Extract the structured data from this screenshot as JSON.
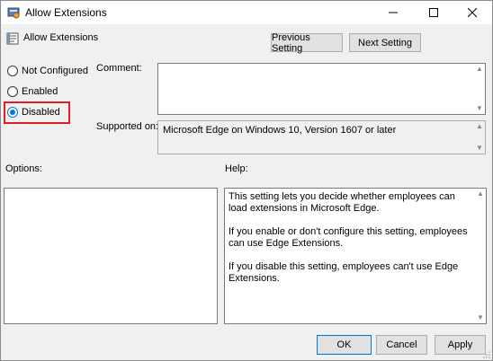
{
  "window": {
    "title": "Allow Extensions",
    "app_icon": "group-policy-icon",
    "controls": [
      "minimize-icon",
      "maximize-icon",
      "close-icon"
    ]
  },
  "header": {
    "policy_name": "Allow Extensions",
    "policy_icon": "policy-setting-icon",
    "previous_label": "Previous Setting",
    "next_label": "Next Setting"
  },
  "state": {
    "options": [
      {
        "label": "Not Configured",
        "selected": false
      },
      {
        "label": "Enabled",
        "selected": false
      },
      {
        "label": "Disabled",
        "selected": true
      }
    ],
    "highlight_color": "#e02020"
  },
  "comment": {
    "label": "Comment:",
    "value": ""
  },
  "supported": {
    "label": "Supported on:",
    "value": "Microsoft Edge on Windows 10, Version 1607 or later"
  },
  "options_panel": {
    "label": "Options:"
  },
  "help_panel": {
    "label": "Help:",
    "paragraphs": [
      "This setting lets you decide whether employees can load extensions in Microsoft Edge.",
      "If you enable or don't configure this setting, employees can use Edge Extensions.",
      "If you disable this setting, employees can't use Edge Extensions."
    ]
  },
  "footer": {
    "ok_label": "OK",
    "cancel_label": "Cancel",
    "apply_label": "Apply"
  },
  "colors": {
    "accent": "#0078d7",
    "background": "#f0f0f0"
  }
}
